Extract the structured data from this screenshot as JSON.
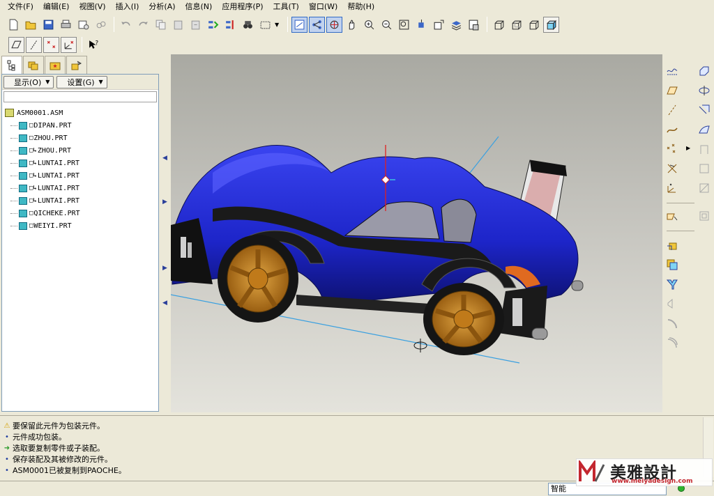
{
  "menu": [
    "文件(F)",
    "编辑(E)",
    "视图(V)",
    "插入(I)",
    "分析(A)",
    "信息(N)",
    "应用程序(P)",
    "工具(T)",
    "窗口(W)",
    "帮助(H)"
  ],
  "navigator": {
    "show_button": "显示(O)",
    "settings_button": "设置(G)",
    "root": "ASM0001.ASM",
    "items": [
      {
        "prefix": "□",
        "name": "DIPAN.PRT"
      },
      {
        "prefix": "□",
        "name": "ZHOU.PRT"
      },
      {
        "prefix": "□↳",
        "name": "ZHOU.PRT"
      },
      {
        "prefix": "□↳",
        "name": "LUNTAI.PRT"
      },
      {
        "prefix": "□↳",
        "name": "LUNTAI.PRT"
      },
      {
        "prefix": "□↳",
        "name": "LUNTAI.PRT"
      },
      {
        "prefix": "□↳",
        "name": "LUNTAI.PRT"
      },
      {
        "prefix": "□",
        "name": "QICHEKE.PRT"
      },
      {
        "prefix": "□",
        "name": "WEIYI.PRT"
      }
    ]
  },
  "messages": [
    {
      "icon": "warning-icon",
      "text": "要保留此元件为包装元件。"
    },
    {
      "icon": "bullet-icon",
      "text": "元件成功包装。"
    },
    {
      "icon": "arrow-icon",
      "text": "选取要复制零件或子装配。"
    },
    {
      "icon": "bullet-icon",
      "text": "保存装配及其被修改的元件。"
    },
    {
      "icon": "bullet-icon",
      "text": "ASM0001已被复制到PAOCHE。"
    }
  ],
  "status": {
    "filter": "智能"
  },
  "watermark": {
    "title": "美雅設計",
    "url": "www.meiyadesign.com"
  },
  "colors": {
    "body": "#1d25c9",
    "rim": "#c8861e",
    "datum": "#3aa0e0",
    "axis_red": "#e02020"
  }
}
